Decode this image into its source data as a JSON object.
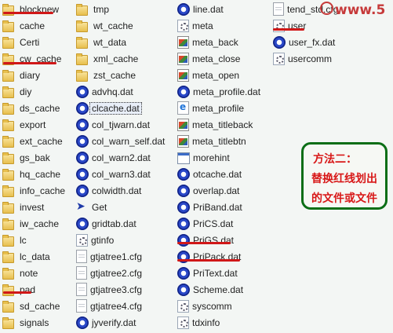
{
  "columns": [
    [
      {
        "name": "blocknew",
        "type": "folder"
      },
      {
        "name": "cache",
        "type": "folder"
      },
      {
        "name": "Certi",
        "type": "folder"
      },
      {
        "name": "cw_cache",
        "type": "folder"
      },
      {
        "name": "diary",
        "type": "folder"
      },
      {
        "name": "diy",
        "type": "folder"
      },
      {
        "name": "ds_cache",
        "type": "folder"
      },
      {
        "name": "export",
        "type": "folder"
      },
      {
        "name": "ext_cache",
        "type": "folder"
      },
      {
        "name": "gs_bak",
        "type": "folder"
      },
      {
        "name": "hq_cache",
        "type": "folder"
      },
      {
        "name": "info_cache",
        "type": "folder"
      },
      {
        "name": "invest",
        "type": "folder"
      },
      {
        "name": "iw_cache",
        "type": "folder"
      },
      {
        "name": "lc",
        "type": "folder"
      },
      {
        "name": "lc_data",
        "type": "folder"
      },
      {
        "name": "note",
        "type": "folder"
      },
      {
        "name": "pad",
        "type": "folder"
      },
      {
        "name": "sd_cache",
        "type": "folder"
      },
      {
        "name": "signals",
        "type": "folder"
      }
    ],
    [
      {
        "name": "tmp",
        "type": "folder"
      },
      {
        "name": "wt_cache",
        "type": "folder"
      },
      {
        "name": "wt_data",
        "type": "folder"
      },
      {
        "name": "xml_cache",
        "type": "folder"
      },
      {
        "name": "zst_cache",
        "type": "folder"
      },
      {
        "name": "advhq.dat",
        "type": "dat"
      },
      {
        "name": "clcache.dat",
        "type": "dat",
        "selected": true
      },
      {
        "name": "col_tjwarn.dat",
        "type": "dat"
      },
      {
        "name": "col_warn_self.dat",
        "type": "dat"
      },
      {
        "name": "col_warn2.dat",
        "type": "dat"
      },
      {
        "name": "col_warn3.dat",
        "type": "dat"
      },
      {
        "name": "colwidth.dat",
        "type": "dat"
      },
      {
        "name": "Get",
        "type": "lnk"
      },
      {
        "name": "gridtab.dat",
        "type": "dat"
      },
      {
        "name": "gtinfo",
        "type": "cfg"
      },
      {
        "name": "gtjatree1.cfg",
        "type": "doc"
      },
      {
        "name": "gtjatree2.cfg",
        "type": "doc"
      },
      {
        "name": "gtjatree3.cfg",
        "type": "doc"
      },
      {
        "name": "gtjatree4.cfg",
        "type": "doc"
      },
      {
        "name": "jyverify.dat",
        "type": "dat"
      }
    ],
    [
      {
        "name": "line.dat",
        "type": "dat"
      },
      {
        "name": "meta",
        "type": "cfg"
      },
      {
        "name": "meta_back",
        "type": "img"
      },
      {
        "name": "meta_close",
        "type": "img"
      },
      {
        "name": "meta_open",
        "type": "img"
      },
      {
        "name": "meta_profile.dat",
        "type": "dat"
      },
      {
        "name": "meta_profile",
        "type": "html"
      },
      {
        "name": "meta_titleback",
        "type": "img"
      },
      {
        "name": "meta_titlebtn",
        "type": "img"
      },
      {
        "name": "morehint",
        "type": "exe"
      },
      {
        "name": "otcache.dat",
        "type": "dat"
      },
      {
        "name": "overlap.dat",
        "type": "dat"
      },
      {
        "name": "PriBand.dat",
        "type": "dat"
      },
      {
        "name": "PriCS.dat",
        "type": "dat"
      },
      {
        "name": "PriGS.dat",
        "type": "dat"
      },
      {
        "name": "PriPack.dat",
        "type": "dat"
      },
      {
        "name": "PriText.dat",
        "type": "dat"
      },
      {
        "name": "Scheme.dat",
        "type": "dat"
      },
      {
        "name": "syscomm",
        "type": "cfg"
      },
      {
        "name": "tdxinfo",
        "type": "cfg"
      }
    ],
    [
      {
        "name": "tend_std.cfg",
        "type": "doc"
      },
      {
        "name": "user",
        "type": "cfg"
      },
      {
        "name": "user_fx.dat",
        "type": "dat"
      },
      {
        "name": "usercomm",
        "type": "cfg"
      }
    ]
  ],
  "annotation": {
    "line1": "方法二：",
    "line2": "替换红线划出",
    "line3": "的文件或文件"
  },
  "watermark": "www.5",
  "colors": {
    "underline": "#d01818",
    "annotation_border": "#0b6e16",
    "annotation_text": "#d81818"
  }
}
